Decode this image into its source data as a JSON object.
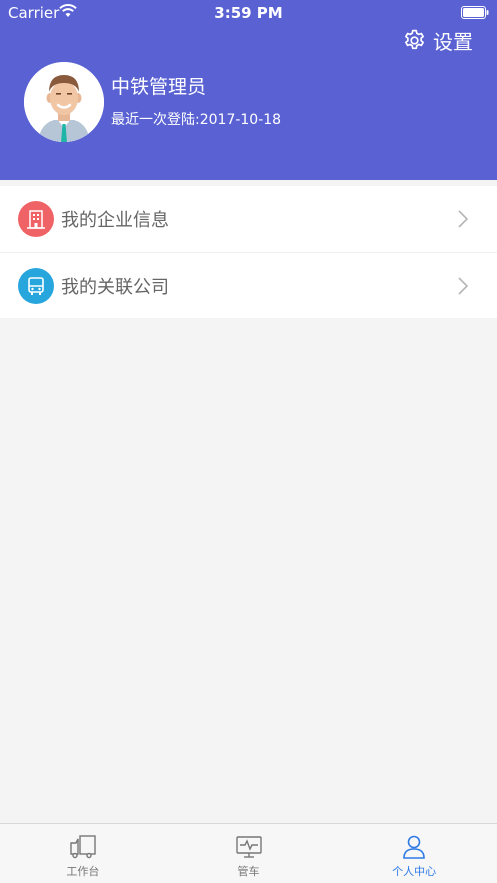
{
  "status_bar": {
    "carrier": "Carrier",
    "time": "3:59 PM"
  },
  "header": {
    "settings_label": "设置",
    "user_name": "中铁管理员",
    "last_login": "最近一次登陆:2017-10-18",
    "background_color": "#5a62d3"
  },
  "menu": {
    "items": [
      {
        "label": "我的企业信息",
        "icon": "building-icon",
        "icon_color": "#ef6366"
      },
      {
        "label": "我的关联公司",
        "icon": "bus-icon",
        "icon_color": "#27a6de"
      }
    ]
  },
  "tabbar": {
    "tabs": [
      {
        "label": "工作台",
        "icon": "truck-icon",
        "active": false
      },
      {
        "label": "管车",
        "icon": "monitor-icon",
        "active": false
      },
      {
        "label": "个人中心",
        "icon": "person-icon",
        "active": true
      }
    ],
    "active_color": "#2f7be5"
  }
}
